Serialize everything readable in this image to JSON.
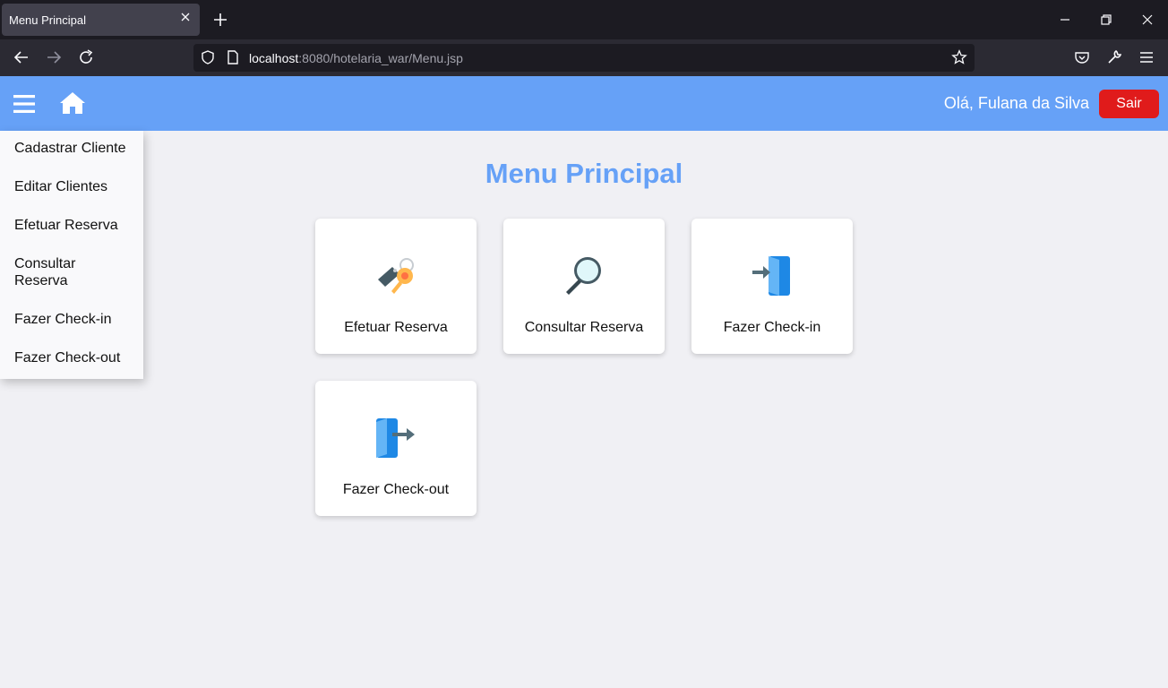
{
  "browser": {
    "tab_title": "Menu Principal",
    "url_host": "localhost",
    "url_rest": ":8080/hotelaria_war/Menu.jsp"
  },
  "header": {
    "greeting": "Olá, Fulana da Silva",
    "logout_label": "Sair"
  },
  "sidebar": {
    "items": [
      {
        "label": "Cadastrar Cliente"
      },
      {
        "label": "Editar Clientes"
      },
      {
        "label": "Efetuar Reserva"
      },
      {
        "label": "Consultar Reserva"
      },
      {
        "label": "Fazer Check-in"
      },
      {
        "label": "Fazer Check-out"
      }
    ]
  },
  "main": {
    "title": "Menu Principal",
    "cards": [
      {
        "label": "Efetuar Reserva",
        "icon": "keys-icon"
      },
      {
        "label": "Consultar Reserva",
        "icon": "magnifier-icon"
      },
      {
        "label": "Fazer Check-in",
        "icon": "door-enter-icon"
      },
      {
        "label": "Fazer Check-out",
        "icon": "door-exit-icon"
      }
    ]
  },
  "colors": {
    "accent": "#66a1f7",
    "danger": "#e01b1b",
    "background": "#f0f0f4"
  }
}
